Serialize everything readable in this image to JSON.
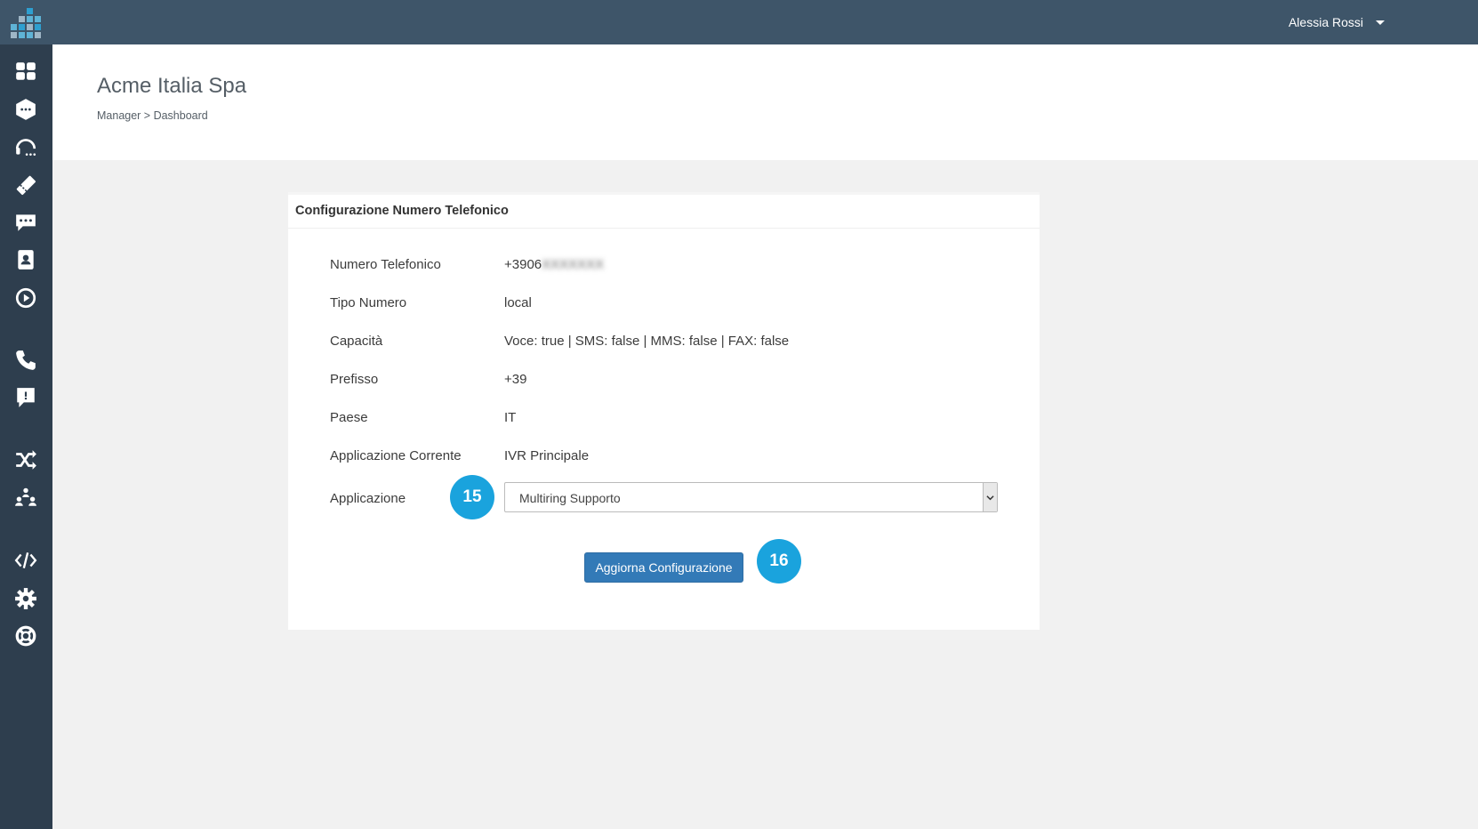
{
  "user": {
    "name": "Alessia Rossi"
  },
  "header": {
    "title": "Acme Italia Spa",
    "breadcrumb": "Manager > Dashboard"
  },
  "sidebar": {
    "icons": [
      "dashboard-icon",
      "hexagon-chat-icon",
      "headset-icon",
      "ticket-icon",
      "chat-bubble-icon",
      "contacts-icon",
      "play-icon",
      "phone-icon",
      "message-icon",
      "shuffle-icon",
      "team-icon",
      "code-icon",
      "gear-icon",
      "lifebuoy-icon"
    ]
  },
  "card": {
    "title": "Configurazione Numero Telefonico",
    "fields": [
      {
        "label": "Numero Telefonico",
        "value": "+3906",
        "value_blurred": "XXXXXXX"
      },
      {
        "label": "Tipo Numero",
        "value": "local"
      },
      {
        "label": "Capacità",
        "value": "Voce: true | SMS: false | MMS: false | FAX: false"
      },
      {
        "label": "Prefisso",
        "value": "+39"
      },
      {
        "label": "Paese",
        "value": "IT"
      },
      {
        "label": "Applicazione Corrente",
        "value": "IVR Principale"
      }
    ],
    "application_label": "Applicazione",
    "help_glyph": "?",
    "application_selected": "Multiring Supporto",
    "submit_label": "Aggiorna Configurazione"
  },
  "markers": {
    "first": "15",
    "second": "16"
  },
  "colors": {
    "topbar": "#3e5569",
    "sidebar": "#2e3e4e",
    "primary_button": "#337ab7",
    "marker": "#1aa3dd"
  }
}
